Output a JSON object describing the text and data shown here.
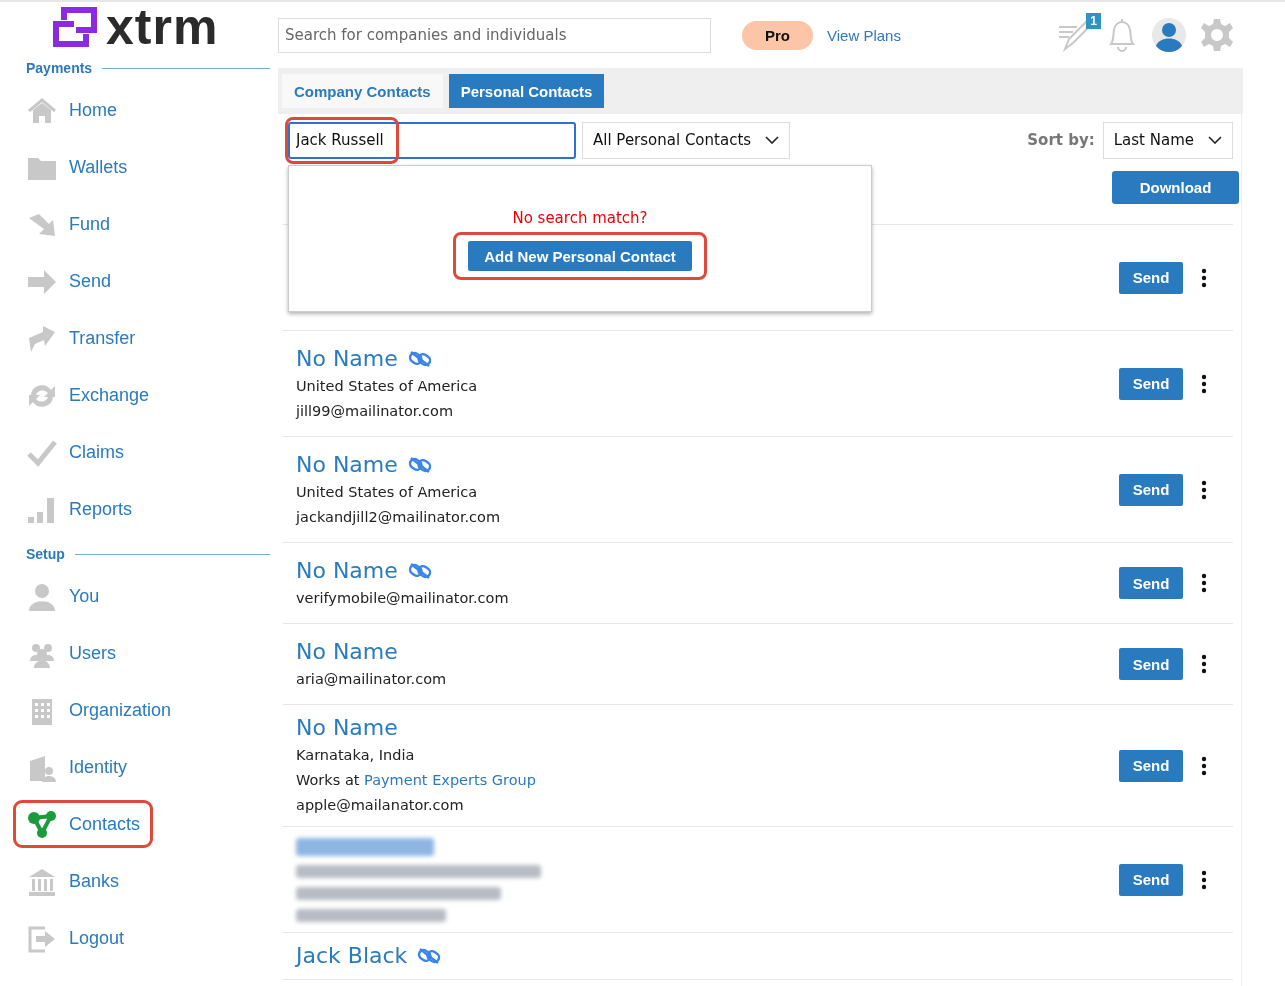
{
  "logo": {
    "text": "xtrm"
  },
  "header": {
    "search": {
      "placeholder": "Search for companies and individuals"
    },
    "plan_badge": "Pro",
    "plans_link": "View Plans",
    "notes_badge": "1"
  },
  "sidebar": {
    "sections": [
      {
        "title": "Payments",
        "items": [
          {
            "label": "Home",
            "selected": false,
            "annotated": false
          },
          {
            "label": "Wallets",
            "selected": false,
            "annotated": false
          },
          {
            "label": "Fund",
            "selected": false,
            "annotated": false
          },
          {
            "label": "Send",
            "selected": false,
            "annotated": false
          },
          {
            "label": "Transfer",
            "selected": false,
            "annotated": false
          },
          {
            "label": "Exchange",
            "selected": false,
            "annotated": false
          },
          {
            "label": "Claims",
            "selected": false,
            "annotated": false
          },
          {
            "label": "Reports",
            "selected": false,
            "annotated": false
          }
        ]
      },
      {
        "title": "Setup",
        "items": [
          {
            "label": "You",
            "selected": false,
            "annotated": false
          },
          {
            "label": "Users",
            "selected": false,
            "annotated": false
          },
          {
            "label": "Organization",
            "selected": false,
            "annotated": false
          },
          {
            "label": "Identity",
            "selected": false,
            "annotated": false
          },
          {
            "label": "Contacts",
            "selected": true,
            "annotated": true
          },
          {
            "label": "Banks",
            "selected": false,
            "annotated": false
          },
          {
            "label": "Logout",
            "selected": false,
            "annotated": false
          }
        ]
      }
    ]
  },
  "tabs": [
    {
      "label": "Company Contacts",
      "selected": false
    },
    {
      "label": "Personal Contacts",
      "selected": true
    }
  ],
  "filter": {
    "search_value": "Jack Russell",
    "search_annotated": true,
    "category": "All Personal Contacts",
    "sort_label": "Sort by:",
    "sort_value": "Last Name",
    "download": "Download"
  },
  "popup": {
    "message": "No search match?",
    "button": "Add New Personal Contact",
    "button_annotated": true
  },
  "contacts": [
    {
      "kind": "covered",
      "send": "Send"
    },
    {
      "kind": "contact",
      "name": "No Name",
      "linked": true,
      "lines": [
        {
          "kind": "text",
          "text": "United States of America"
        },
        {
          "kind": "text",
          "text": "jill99@mailinator.com"
        }
      ],
      "send": "Send"
    },
    {
      "kind": "contact",
      "name": "No Name",
      "linked": true,
      "lines": [
        {
          "kind": "text",
          "text": "United States of America"
        },
        {
          "kind": "text",
          "text": "jackandjill2@mailinator.com"
        }
      ],
      "send": "Send"
    },
    {
      "kind": "contact",
      "name": "No Name",
      "linked": true,
      "lines": [
        {
          "kind": "text",
          "text": "verifymobile@mailinator.com"
        }
      ],
      "send": "Send"
    },
    {
      "kind": "contact",
      "name": "No Name",
      "linked": false,
      "lines": [
        {
          "kind": "text",
          "text": "aria@mailinator.com"
        }
      ],
      "send": "Send"
    },
    {
      "kind": "contact",
      "name": "No Name",
      "linked": false,
      "lines": [
        {
          "kind": "text",
          "text": "Karnataka, India"
        },
        {
          "kind": "works_at",
          "prefix": "Works at",
          "link": "Payment Experts Group"
        },
        {
          "kind": "text",
          "text": "apple@mailanator.com"
        }
      ],
      "send": "Send"
    },
    {
      "kind": "blurred",
      "send": "Send"
    },
    {
      "kind": "partial",
      "name": "Jack Black",
      "linked": true
    }
  ]
}
